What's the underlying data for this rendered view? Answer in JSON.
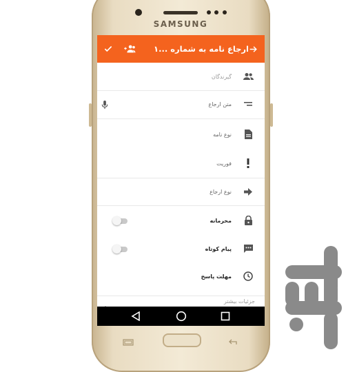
{
  "device": {
    "brand": "SAMSUNG"
  },
  "appbar": {
    "title": "ارجاع نامه به شماره ...۱",
    "back_icon": "arrow-right-icon",
    "recipients_icon": "group-add-icon",
    "confirm_icon": "check-icon",
    "color": "#f4631e"
  },
  "form": {
    "recipients": {
      "label": "گیرندگان",
      "icon": "people-icon"
    },
    "referral_text": {
      "label": "متن ارجاع",
      "icon": "short-text-icon",
      "mic_icon": "microphone-icon"
    },
    "letter_type": {
      "label": "نوع نامه",
      "icon": "document-icon"
    },
    "urgency": {
      "label": "فوریت",
      "icon": "exclamation-icon"
    },
    "referral_type": {
      "label": "نوع ارجاع",
      "icon": "arrow-forward-icon"
    },
    "confidential": {
      "label": "محرمانه",
      "icon": "lock-icon",
      "enabled": false
    },
    "sms": {
      "label": "پیام کوتاه",
      "icon": "message-icon",
      "enabled": false
    },
    "deadline": {
      "label": "مهلت پاسخ",
      "icon": "clock-icon"
    },
    "more": {
      "label": "جزئیات بیشتر",
      "icon": "chevron-up-icon"
    }
  },
  "navbar": {
    "back_icon": "triangle-back-icon",
    "home_icon": "circle-home-icon",
    "recents_icon": "square-recents-icon"
  }
}
